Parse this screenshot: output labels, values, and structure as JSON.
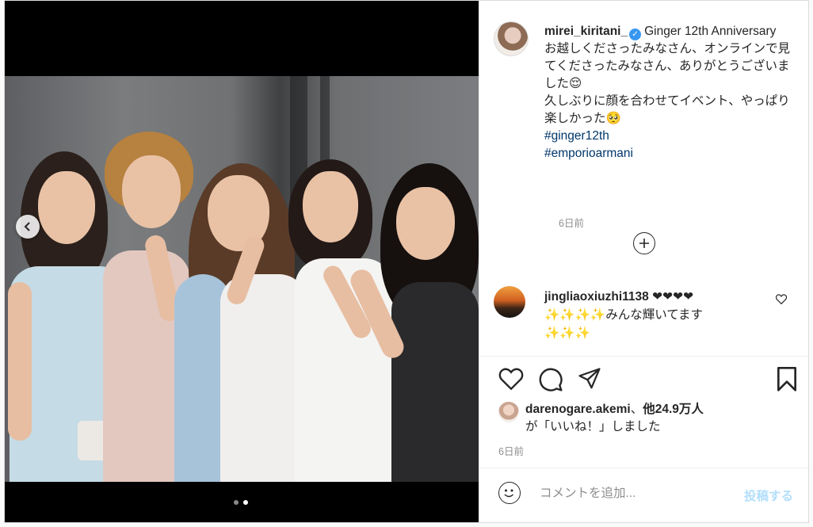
{
  "post": {
    "carousel": {
      "dot_count": 2,
      "active_index": 1
    },
    "caption": {
      "username": "mirei_kiritani_",
      "verified_icon": "verified-badge-icon",
      "text_line1": "Ginger 12th Anniversary",
      "text_line2": "お越しくださったみなさん、オンラインで見てくださったみなさん、ありがとうございました😌",
      "text_line3": "久しぶりに顔を合わせてイベント、やっぱり楽しかった🥺",
      "hashtags": [
        "#ginger12th",
        "#emporioarmani"
      ],
      "time": "6日前"
    },
    "load_more_icon": "plus-circle-icon",
    "comments": [
      {
        "username": "jingliaoxiuzhi1138",
        "text_line1": "❤❤❤❤",
        "text_line2": "✨✨✨✨みんな輝いてます",
        "text_line3": "✨✨✨"
      }
    ],
    "actions": {
      "like_icon": "heart-icon",
      "comment_icon": "comment-bubble-icon",
      "share_icon": "paper-plane-icon",
      "save_icon": "bookmark-icon"
    },
    "likes": {
      "liker": "darenogare.akemi",
      "separator": "、",
      "others": "他24.9万人",
      "suffix": "が「いいね！」しました"
    },
    "post_time": "6日前",
    "comment_box": {
      "placeholder": "コメントを追加...",
      "post_label": "投稿する",
      "emoji_icon": "smiley-icon"
    },
    "colors": {
      "hashtag": "#00376b",
      "post_button_disabled": "#b2dffc",
      "verified": "#3897f0",
      "secondary_text": "#8e8e8e"
    }
  }
}
